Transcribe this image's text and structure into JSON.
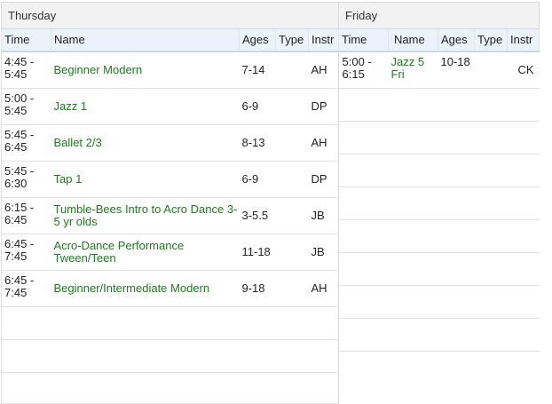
{
  "thursday": {
    "label": "Thursday",
    "columns": [
      "Time",
      "Name",
      "Ages",
      "Type",
      "Instr"
    ],
    "rows": [
      {
        "time": "4:45 - 5:45",
        "name": "Beginner Modern",
        "ages": "7-14",
        "type": "",
        "instr": "AH"
      },
      {
        "time": "5:00 - 5:45",
        "name": "Jazz 1",
        "ages": "6-9",
        "type": "",
        "instr": "DP"
      },
      {
        "time": "5:45 - 6:45",
        "name": "Ballet 2/3",
        "ages": "8-13",
        "type": "",
        "instr": "AH"
      },
      {
        "time": "5:45 - 6:30",
        "name": "Tap 1",
        "ages": "6-9",
        "type": "",
        "instr": "DP"
      },
      {
        "time": "6:15 - 6:45",
        "name": "Tumble-Bees Intro to Acro Dance 3-5 yr olds",
        "ages": "3-5.5",
        "type": "",
        "instr": "JB"
      },
      {
        "time": "6:45 - 7:45",
        "name": "Acro-Dance Performance Tween/Teen",
        "ages": "11-18",
        "type": "",
        "instr": "JB"
      },
      {
        "time": "6:45 - 7:45",
        "name": "Beginner/Intermediate Modern",
        "ages": "9-18",
        "type": "",
        "instr": "AH"
      }
    ]
  },
  "friday": {
    "label": "Friday",
    "columns": [
      "Time",
      "Name",
      "Ages",
      "Type",
      "Instr"
    ],
    "rows": [
      {
        "time": "5:00 - 6:15",
        "name": "Jazz 5 Fri",
        "ages": "10-18",
        "type": "",
        "instr": "CK"
      }
    ]
  }
}
